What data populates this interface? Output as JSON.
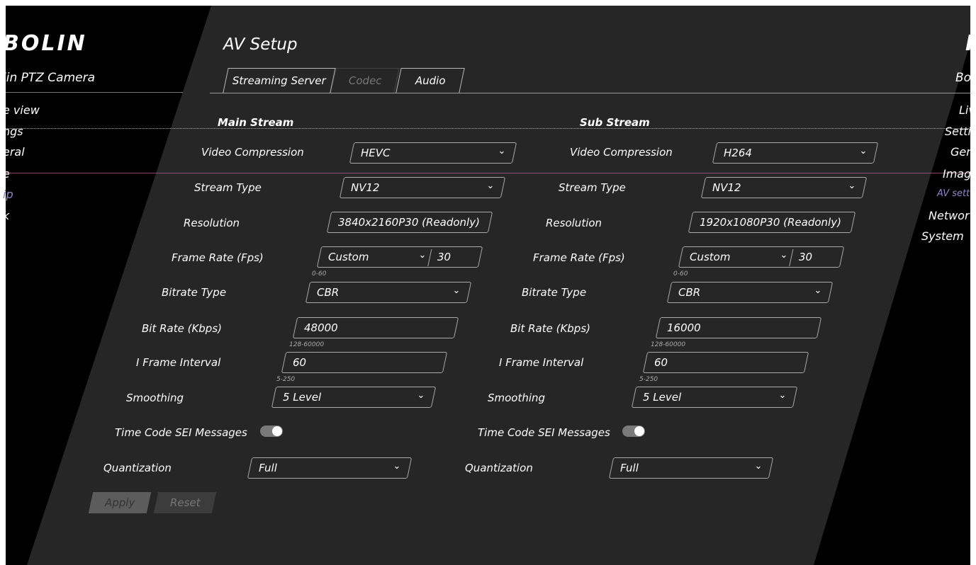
{
  "brand": {
    "logo": "BOLIN",
    "camera_title": "lin PTZ Camera",
    "logo_right": "I",
    "camera_title_right": "Bo"
  },
  "left_nav": [
    "e view",
    "ngs",
    "eral",
    "e",
    "ip",
    "k"
  ],
  "right_nav": [
    "Live",
    "Setti",
    "Gen",
    "Image",
    "AV sett",
    "Networ",
    "System"
  ],
  "page_title": "AV Setup",
  "tabs": [
    "Streaming Server",
    "Codec",
    "Audio"
  ],
  "main": {
    "title": "Main Stream",
    "video_compression_label": "Video Compression",
    "video_compression": "HEVC",
    "stream_type_label": "Stream Type",
    "stream_type": "NV12",
    "resolution_label": "Resolution",
    "resolution": "3840x2160P30 (Readonly)",
    "frame_rate_label": "Frame Rate (Fps)",
    "frame_rate_mode": "Custom",
    "frame_rate": "30",
    "frame_rate_hint": "0-60",
    "bitrate_type_label": "Bitrate Type",
    "bitrate_type": "CBR",
    "bit_rate_label": "Bit Rate (Kbps)",
    "bit_rate": "48000",
    "bit_rate_hint": "128-60000",
    "i_frame_label": "I Frame Interval",
    "i_frame": "60",
    "i_frame_hint": "5-250",
    "smoothing_label": "Smoothing",
    "smoothing": "5 Level",
    "timecode_label": "Time Code SEI Messages",
    "quantization_label": "Quantization",
    "quantization": "Full"
  },
  "sub": {
    "title": "Sub Stream",
    "video_compression_label": "Video Compression",
    "video_compression": "H264",
    "stream_type_label": "Stream Type",
    "stream_type": "NV12",
    "resolution_label": "Resolution",
    "resolution": "1920x1080P30 (Readonly)",
    "frame_rate_label": "Frame Rate (Fps)",
    "frame_rate_mode": "Custom",
    "frame_rate": "30",
    "frame_rate_hint": "0-60",
    "bitrate_type_label": "Bitrate Type",
    "bitrate_type": "CBR",
    "bit_rate_label": "Bit Rate (Kbps)",
    "bit_rate": "16000",
    "bit_rate_hint": "128-60000",
    "i_frame_label": "I Frame Interval",
    "i_frame": "60",
    "i_frame_hint": "5-250",
    "smoothing_label": "Smoothing",
    "smoothing": "5 Level",
    "timecode_label": "Time Code SEI Messages",
    "quantization_label": "Quantization",
    "quantization": "Full"
  },
  "buttons": {
    "apply": "Apply",
    "reset": "Reset"
  },
  "icons": {
    "dropdown": "chevron-down-icon",
    "toggle": "toggle-switch-on"
  },
  "colors": {
    "panel": "#262626",
    "background": "#000000",
    "active_nav": "#8d86c9",
    "accent_line": "#b36b8e"
  }
}
